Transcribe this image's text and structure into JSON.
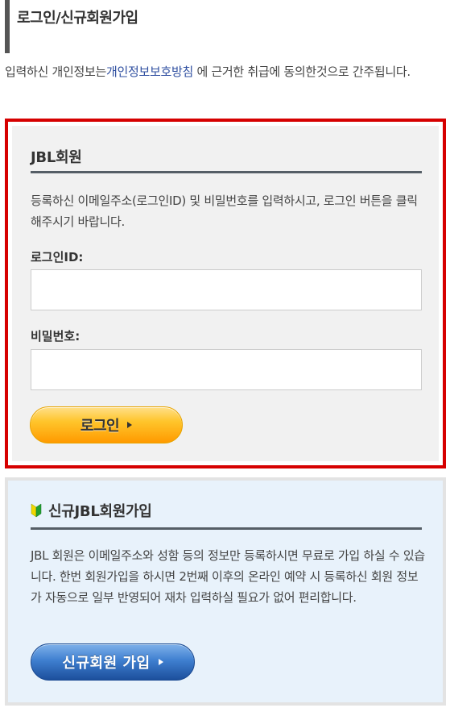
{
  "page": {
    "title": "로그인/신규회원가입"
  },
  "intro": {
    "before_link": "입력하신 개인정보는",
    "link_text": "개인정보보호방침",
    "after_link": " 에 근거한 취급에 동의한것으로 간주됩니다."
  },
  "login": {
    "title": "JBL회원",
    "description": "등록하신 이메일주소(로그인ID) 및 비밀번호를 입력하시고, 로그인 버튼을 클릭해주시기 바랍니다.",
    "id_label": "로그인ID:",
    "id_value": "",
    "id_placeholder": "",
    "password_label": "비밀번호:",
    "password_value": "",
    "password_placeholder": "",
    "button_label": "로그인"
  },
  "signup": {
    "title": "신규JBL회원가입",
    "description": "JBL 회원은 이메일주소와 성함 등의 정보만 등록하시면 무료로 가입 하실 수 있습니다. 한번 회원가입을 하시면 2번째 이후의 온라인 예약 시 등록하신 회원 정보가 자동으로 일부 반영되어 재차 입력하실 필요가 없어 편리합니다.",
    "button_label": "신규회원 가입"
  },
  "colors": {
    "accent_red": "#d60000",
    "link_blue": "#2f4fa0",
    "login_button_orange": "#ffc52b",
    "signup_button_blue": "#3f7fd0",
    "signup_background": "#e8f2fb"
  }
}
